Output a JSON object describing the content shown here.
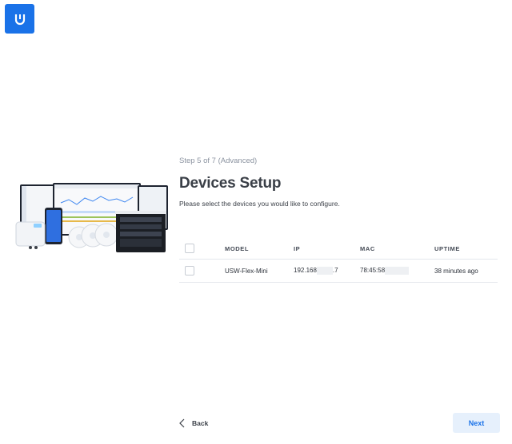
{
  "app": {
    "logo_icon": "ubiquiti-u-logo-icon",
    "brand_color": "#1a72e8"
  },
  "wizard": {
    "step_text": "Step 5 of 7 (Advanced)",
    "title": "Devices Setup",
    "subtitle": "Please select the devices you would like to configure."
  },
  "table": {
    "columns": [
      "MODEL",
      "IP",
      "MAC",
      "UPTIME"
    ],
    "rows": [
      {
        "model": "USW-Flex-Mini",
        "ip_prefix": "192.168",
        "ip_suffix": ".7",
        "mac_prefix": "78:45:58",
        "uptime": "38 minutes ago",
        "selected": false
      }
    ],
    "select_all": false
  },
  "footer": {
    "back_label": "Back",
    "next_label": "Next"
  }
}
